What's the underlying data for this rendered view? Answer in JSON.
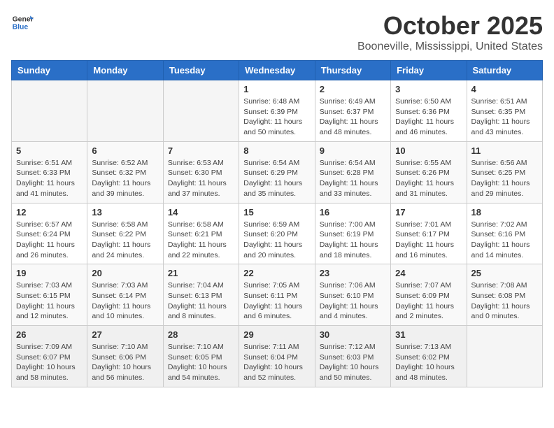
{
  "header": {
    "logo_line1": "General",
    "logo_line2": "Blue",
    "month": "October 2025",
    "location": "Booneville, Mississippi, United States"
  },
  "weekdays": [
    "Sunday",
    "Monday",
    "Tuesday",
    "Wednesday",
    "Thursday",
    "Friday",
    "Saturday"
  ],
  "weeks": [
    [
      {
        "day": "",
        "info": ""
      },
      {
        "day": "",
        "info": ""
      },
      {
        "day": "",
        "info": ""
      },
      {
        "day": "1",
        "info": "Sunrise: 6:48 AM\nSunset: 6:39 PM\nDaylight: 11 hours\nand 50 minutes."
      },
      {
        "day": "2",
        "info": "Sunrise: 6:49 AM\nSunset: 6:37 PM\nDaylight: 11 hours\nand 48 minutes."
      },
      {
        "day": "3",
        "info": "Sunrise: 6:50 AM\nSunset: 6:36 PM\nDaylight: 11 hours\nand 46 minutes."
      },
      {
        "day": "4",
        "info": "Sunrise: 6:51 AM\nSunset: 6:35 PM\nDaylight: 11 hours\nand 43 minutes."
      }
    ],
    [
      {
        "day": "5",
        "info": "Sunrise: 6:51 AM\nSunset: 6:33 PM\nDaylight: 11 hours\nand 41 minutes."
      },
      {
        "day": "6",
        "info": "Sunrise: 6:52 AM\nSunset: 6:32 PM\nDaylight: 11 hours\nand 39 minutes."
      },
      {
        "day": "7",
        "info": "Sunrise: 6:53 AM\nSunset: 6:30 PM\nDaylight: 11 hours\nand 37 minutes."
      },
      {
        "day": "8",
        "info": "Sunrise: 6:54 AM\nSunset: 6:29 PM\nDaylight: 11 hours\nand 35 minutes."
      },
      {
        "day": "9",
        "info": "Sunrise: 6:54 AM\nSunset: 6:28 PM\nDaylight: 11 hours\nand 33 minutes."
      },
      {
        "day": "10",
        "info": "Sunrise: 6:55 AM\nSunset: 6:26 PM\nDaylight: 11 hours\nand 31 minutes."
      },
      {
        "day": "11",
        "info": "Sunrise: 6:56 AM\nSunset: 6:25 PM\nDaylight: 11 hours\nand 29 minutes."
      }
    ],
    [
      {
        "day": "12",
        "info": "Sunrise: 6:57 AM\nSunset: 6:24 PM\nDaylight: 11 hours\nand 26 minutes."
      },
      {
        "day": "13",
        "info": "Sunrise: 6:58 AM\nSunset: 6:22 PM\nDaylight: 11 hours\nand 24 minutes."
      },
      {
        "day": "14",
        "info": "Sunrise: 6:58 AM\nSunset: 6:21 PM\nDaylight: 11 hours\nand 22 minutes."
      },
      {
        "day": "15",
        "info": "Sunrise: 6:59 AM\nSunset: 6:20 PM\nDaylight: 11 hours\nand 20 minutes."
      },
      {
        "day": "16",
        "info": "Sunrise: 7:00 AM\nSunset: 6:19 PM\nDaylight: 11 hours\nand 18 minutes."
      },
      {
        "day": "17",
        "info": "Sunrise: 7:01 AM\nSunset: 6:17 PM\nDaylight: 11 hours\nand 16 minutes."
      },
      {
        "day": "18",
        "info": "Sunrise: 7:02 AM\nSunset: 6:16 PM\nDaylight: 11 hours\nand 14 minutes."
      }
    ],
    [
      {
        "day": "19",
        "info": "Sunrise: 7:03 AM\nSunset: 6:15 PM\nDaylight: 11 hours\nand 12 minutes."
      },
      {
        "day": "20",
        "info": "Sunrise: 7:03 AM\nSunset: 6:14 PM\nDaylight: 11 hours\nand 10 minutes."
      },
      {
        "day": "21",
        "info": "Sunrise: 7:04 AM\nSunset: 6:13 PM\nDaylight: 11 hours\nand 8 minutes."
      },
      {
        "day": "22",
        "info": "Sunrise: 7:05 AM\nSunset: 6:11 PM\nDaylight: 11 hours\nand 6 minutes."
      },
      {
        "day": "23",
        "info": "Sunrise: 7:06 AM\nSunset: 6:10 PM\nDaylight: 11 hours\nand 4 minutes."
      },
      {
        "day": "24",
        "info": "Sunrise: 7:07 AM\nSunset: 6:09 PM\nDaylight: 11 hours\nand 2 minutes."
      },
      {
        "day": "25",
        "info": "Sunrise: 7:08 AM\nSunset: 6:08 PM\nDaylight: 11 hours\nand 0 minutes."
      }
    ],
    [
      {
        "day": "26",
        "info": "Sunrise: 7:09 AM\nSunset: 6:07 PM\nDaylight: 10 hours\nand 58 minutes."
      },
      {
        "day": "27",
        "info": "Sunrise: 7:10 AM\nSunset: 6:06 PM\nDaylight: 10 hours\nand 56 minutes."
      },
      {
        "day": "28",
        "info": "Sunrise: 7:10 AM\nSunset: 6:05 PM\nDaylight: 10 hours\nand 54 minutes."
      },
      {
        "day": "29",
        "info": "Sunrise: 7:11 AM\nSunset: 6:04 PM\nDaylight: 10 hours\nand 52 minutes."
      },
      {
        "day": "30",
        "info": "Sunrise: 7:12 AM\nSunset: 6:03 PM\nDaylight: 10 hours\nand 50 minutes."
      },
      {
        "day": "31",
        "info": "Sunrise: 7:13 AM\nSunset: 6:02 PM\nDaylight: 10 hours\nand 48 minutes."
      },
      {
        "day": "",
        "info": ""
      }
    ]
  ]
}
